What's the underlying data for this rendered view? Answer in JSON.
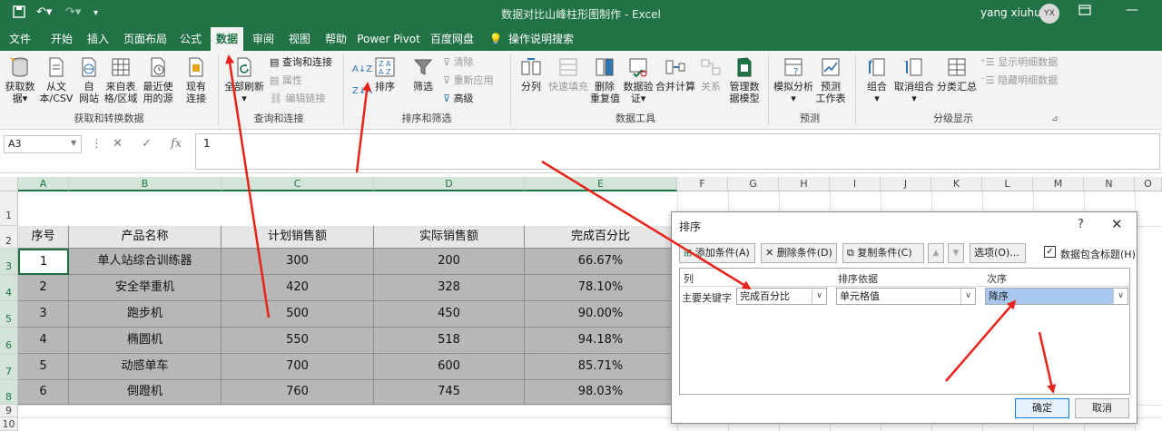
{
  "titlebar": {
    "title": "数据对比山峰柱形图制作 - Excel",
    "user": "yang xiuhui",
    "avatar": "YX"
  },
  "tabs": [
    "文件",
    "开始",
    "插入",
    "页面布局",
    "公式",
    "数据",
    "审阅",
    "视图",
    "帮助",
    "Power Pivot",
    "百度网盘",
    "操作说明搜索"
  ],
  "ribbon": {
    "get": {
      "get_data": "获取数\n据▾",
      "from_text": "从文\n本/CSV",
      "from_web": "自\n网站",
      "from_table": "来自表\n格/区域",
      "recent": "最近使\n用的源",
      "existing": "现有\n连接",
      "label": "获取和转换数据"
    },
    "query": {
      "refresh": "全部刷新",
      "queries": "查询和连接",
      "props": "属性",
      "edit_links": "编辑链接",
      "label": "查询和连接"
    },
    "sort": {
      "az": "A↓Z",
      "za": "Z↓A",
      "sort": "排序",
      "filter": "筛选",
      "clear": "清除",
      "reapply": "重新应用",
      "advanced": "高级",
      "label": "排序和筛选"
    },
    "tools": {
      "split": "分列",
      "flash": "快速填充",
      "dup": "删除\n重复值",
      "validate": "数据验\n证▾",
      "consolidate": "合并计算",
      "relations": "关系",
      "model": "管理数\n据模型",
      "label": "数据工具"
    },
    "forecast": {
      "whatif": "模拟分析",
      "sheet": "预测\n工作表",
      "label": "预测"
    },
    "outline": {
      "group": "组合",
      "ungroup": "取消组合",
      "subtotal": "分类汇总",
      "show": "显示明细数据",
      "hide": "隐藏明细数据",
      "label": "分级显示"
    }
  },
  "formula": {
    "namebox": "A3",
    "fx": "fx",
    "value": "1"
  },
  "grid": {
    "columns": [
      "A",
      "B",
      "C",
      "D",
      "E",
      "F",
      "G",
      "H",
      "I",
      "J",
      "K",
      "L",
      "M",
      "N",
      "O"
    ],
    "rows": [
      "1",
      "2",
      "3",
      "4",
      "5",
      "6",
      "7",
      "8",
      "9",
      "10"
    ],
    "header": [
      "序号",
      "产品名称",
      "计划销售额",
      "实际销售额",
      "完成百分比"
    ],
    "data": [
      [
        "1",
        "单人站综合训练器",
        "300",
        "200",
        "66.67%"
      ],
      [
        "2",
        "安全举重机",
        "420",
        "328",
        "78.10%"
      ],
      [
        "3",
        "跑步机",
        "500",
        "450",
        "90.00%"
      ],
      [
        "4",
        "椭圆机",
        "550",
        "518",
        "94.18%"
      ],
      [
        "5",
        "动感单车",
        "700",
        "600",
        "85.71%"
      ],
      [
        "6",
        "倒蹬机",
        "760",
        "745",
        "98.03%"
      ]
    ]
  },
  "dialog": {
    "title": "排序",
    "help": "?",
    "add": "添加条件(A)",
    "delete": "删除条件(D)",
    "copy": "复制条件(C)",
    "up": "▲",
    "down": "▼",
    "options": "选项(O)...",
    "has_header": "数据包含标题(H)",
    "col_header": "列",
    "sort_on_header": "排序依据",
    "order_header": "次序",
    "row_label": "主要关键字",
    "key": "完成百分比",
    "sort_on": "单元格值",
    "order": "降序",
    "ok": "确定",
    "cancel": "取消"
  },
  "colors": {
    "excel_green": "#217346",
    "arrow_red": "#e8231a",
    "cell_gray": "#b7b7b7"
  }
}
